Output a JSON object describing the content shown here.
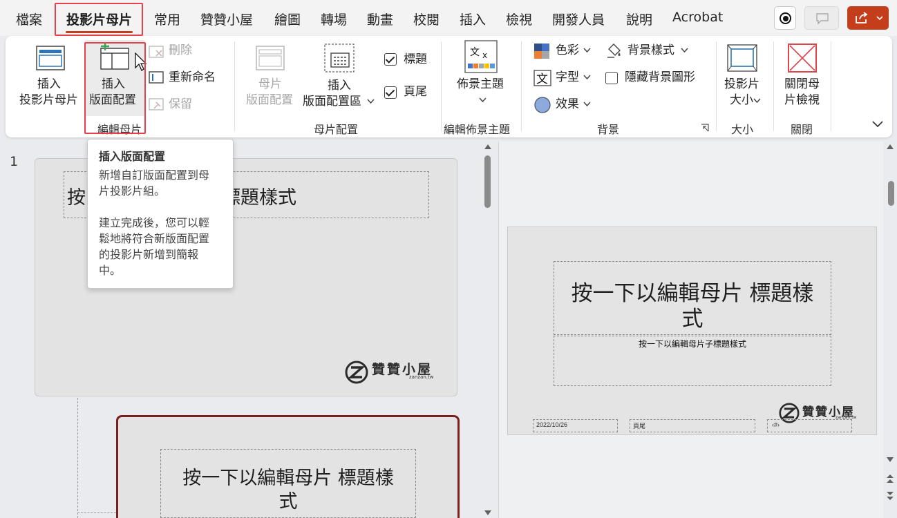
{
  "tabs": [
    {
      "label": "檔案"
    },
    {
      "label": "投影片母片"
    },
    {
      "label": "常用"
    },
    {
      "label": "贊贊小屋"
    },
    {
      "label": "繪圖"
    },
    {
      "label": "轉場"
    },
    {
      "label": "動畫"
    },
    {
      "label": "校閱"
    },
    {
      "label": "插入"
    },
    {
      "label": "檢視"
    },
    {
      "label": "開發人員"
    },
    {
      "label": "說明"
    },
    {
      "label": "Acrobat"
    }
  ],
  "ribbon": {
    "edit_master": {
      "insert_slide_master": [
        "插入",
        "投影片母片"
      ],
      "insert_layout": [
        "插入",
        "版面配置"
      ],
      "delete": "刪除",
      "rename": "重新命名",
      "preserve": "保留",
      "group": "編輯母片"
    },
    "master_layout": {
      "master_layout_btn": [
        "母片",
        "版面配置"
      ],
      "insert_placeholder": [
        "插入",
        "版面配置區"
      ],
      "title_check": "標題",
      "footer_check": "頁尾",
      "group": "母片配置"
    },
    "edit_theme": {
      "themes": "佈景主題",
      "group": "編輯佈景主題"
    },
    "background": {
      "colors": "色彩",
      "fonts": "字型",
      "effects": "效果",
      "bg_styles": "背景樣式",
      "hide_bg": "隱藏背景圖形",
      "group": "背景"
    },
    "size": {
      "slide_size": [
        "投影片",
        "大小"
      ],
      "group": "大小"
    },
    "close": {
      "close_master": [
        "關閉母",
        "片檢視"
      ],
      "group": "關閉"
    }
  },
  "tooltip": {
    "title": "插入版面配置",
    "body1": [
      "新增自訂版面配置到母",
      "片投影片組。"
    ],
    "body2": [
      "建立完成後，您可以輕",
      "鬆地將符合新版面配置",
      "的投影片新增到簡報",
      "中。"
    ]
  },
  "thumbnails": {
    "number": "1",
    "thumb1_title_left": "按",
    "thumb1_title_right": "標題樣式",
    "logo_text": "贊贊小屋",
    "logo_url": "zanzan.tw",
    "thumb2_title": [
      "按一下以編輯母片 標題樣",
      "式"
    ]
  },
  "slide": {
    "title": [
      "按一下以編輯母片 標題樣",
      "式"
    ],
    "subtitle": "按一下以編輯母片子標題樣式",
    "date": "2022/10/26",
    "footer": "頁尾",
    "page": "‹#›",
    "logo_text": "贊贊小屋",
    "logo_url": "zanzan.tw"
  },
  "colors": {
    "accent": "#c43e1c",
    "highlight": "#e8404a",
    "selected_border": "#7b1e1e"
  }
}
